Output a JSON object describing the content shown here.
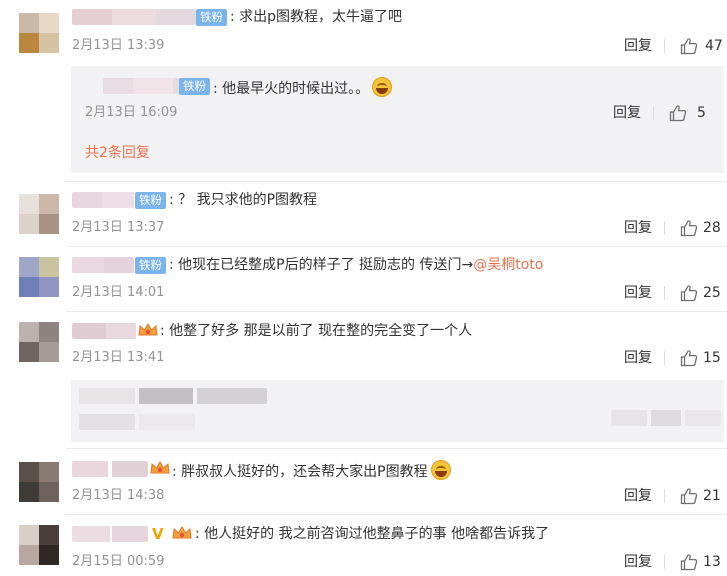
{
  "comments": [
    {
      "badge": "铁粉",
      "text": ": 求出p图教程，太牛逼了吧",
      "time": "2月13日 13:39",
      "reply": "回复",
      "likes": "47",
      "sub": {
        "badge": "铁粉",
        "text": ": 他最早火的时候出过。。",
        "time": "2月13日 16:09",
        "reply": "回复",
        "likes": "5",
        "more": "共2条回复"
      }
    },
    {
      "badge": "铁粉",
      "text": ": ？ 我只求他的P图教程",
      "time": "2月13日 13:37",
      "reply": "回复",
      "likes": "28"
    },
    {
      "badge": "铁粉",
      "text": ": 他现在已经整成P后的样子了 挺励志的 传送门→",
      "link": "@吴桐toto",
      "time": "2月13日 14:01",
      "reply": "回复",
      "likes": "25"
    },
    {
      "text": ": 他整了好多 那是以前了 现在整的完全变了一个人",
      "time": "2月13日 13:41",
      "reply": "回复",
      "likes": "15"
    },
    {
      "text": ": 胖叔叔人挺好的，还会帮大家出P图教程",
      "time": "2月13日 14:38",
      "reply": "回复",
      "likes": "21"
    },
    {
      "text": ": 他人挺好的 我之前咨询过他整鼻子的事  他啥都告诉我了",
      "time": "2月15日 00:59",
      "reply": "回复",
      "likes": "13"
    }
  ],
  "colors": {
    "badge_bg": "#7ab4ea",
    "link": "#eb7350",
    "time": "#939393",
    "reply_box_bg": "#f2f2f5"
  },
  "icons": [
    "like-thumb-icon",
    "laughing-emoji-icon",
    "fan-crown-icon",
    "verified-v-icon"
  ]
}
